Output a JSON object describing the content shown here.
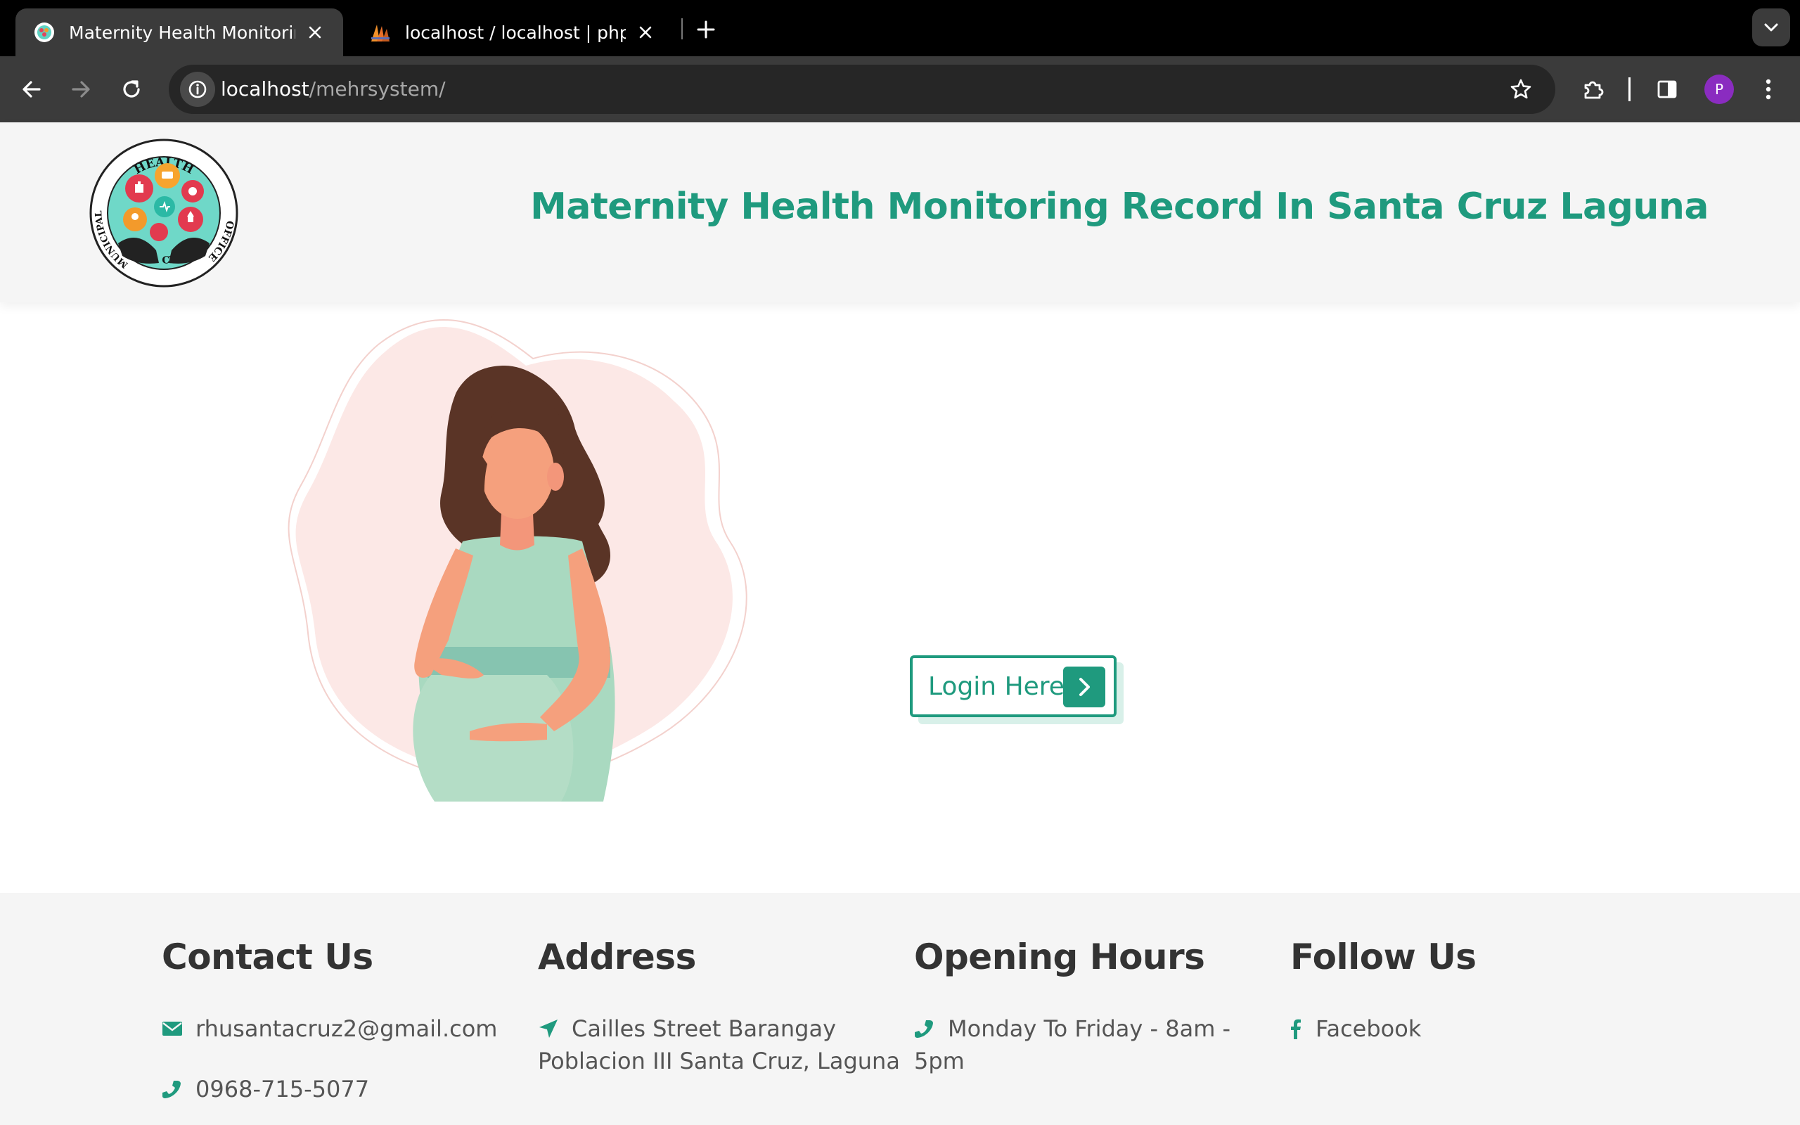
{
  "browser": {
    "tabs": [
      {
        "title": "Maternity Health Monitoring Record In Santa Cruz Laguna",
        "active": true,
        "favicon": "seal-icon"
      },
      {
        "title": "localhost / localhost | phpMyAdmin",
        "active": false,
        "favicon": "phpmyadmin-icon"
      }
    ],
    "url_host": "localhost",
    "url_path": "/mehrsystem/",
    "profile_initial": "P"
  },
  "header": {
    "title": "Maternity Health Monitoring Record In Santa Cruz Laguna",
    "logo_text_top": "HEALTH",
    "logo_text_left": "MUNICIPAL",
    "logo_text_right": "OFFICE",
    "logo_text_bottom": "STA. CRUZ"
  },
  "hero": {
    "login_label": "Login Here"
  },
  "footer": {
    "contact": {
      "heading": "Contact Us",
      "email": "rhusantacruz2@gmail.com",
      "phone": "0968-715-5077"
    },
    "address": {
      "heading": "Address",
      "text": "Cailles Street Barangay Poblacion III Santa Cruz, Laguna"
    },
    "hours": {
      "heading": "Opening Hours",
      "text": "Monday To Friday - 8am - 5pm"
    },
    "follow": {
      "heading": "Follow Us",
      "facebook": "Facebook"
    }
  },
  "colors": {
    "brand": "#1f9a7e",
    "heading_text": "#333333",
    "footer_bg": "#f5f5f5",
    "chrome_bg": "#000000",
    "toolbar_bg": "#3b3b3b"
  }
}
